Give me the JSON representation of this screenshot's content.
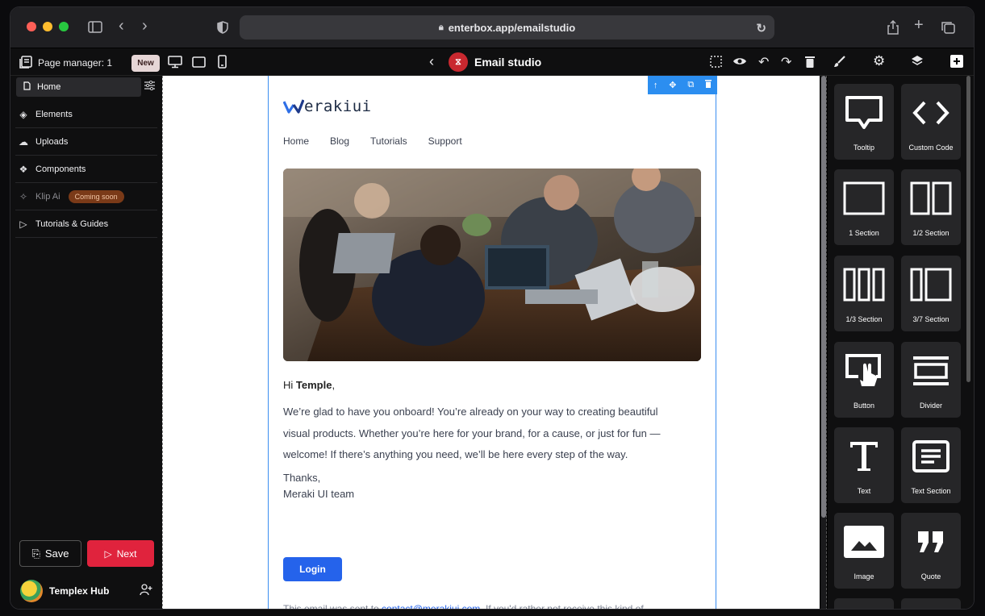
{
  "browser": {
    "url": "enterbox.app/emailstudio",
    "lock_icon": "lock-icon"
  },
  "toolbar": {
    "page_manager": "Page manager: 1",
    "new_badge": "New",
    "title": "Email studio"
  },
  "sidebar": {
    "home": "Home",
    "items": [
      {
        "label": "Elements",
        "icon": "elements-icon"
      },
      {
        "label": "Uploads",
        "icon": "upload-icon"
      },
      {
        "label": "Components",
        "icon": "components-icon"
      },
      {
        "label": "Klip Ai",
        "icon": "magic-icon",
        "badge": "Coming soon"
      },
      {
        "label": "Tutorials & Guides",
        "icon": "video-icon"
      }
    ],
    "save": "Save",
    "next": "Next",
    "hub": "Templex Hub"
  },
  "email": {
    "brand": "erakiui",
    "nav": [
      "Home",
      "Blog",
      "Tutorials",
      "Support"
    ],
    "greeting_prefix": "Hi ",
    "greeting_name": "Temple",
    "greeting_suffix": ",",
    "body": "We’re glad to have you onboard! You’re already on your way to creating beautiful visual products. Whether you’re here for your brand, for a cause, or just for fun — welcome! If there’s anything you need, we’ll be here every step of the way.",
    "thanks": "Thanks,",
    "signature": "Meraki UI team",
    "login": "Login",
    "footer_prefix": "This email was sent to ",
    "footer_email": "contact@merakiui.com",
    "footer_suffix": ". If you'd rather not receive this kind of"
  },
  "panel": {
    "tiles": [
      "Tooltip",
      "Custom Code",
      "1 Section",
      "1/2 Section",
      "1/3 Section",
      "3/7 Section",
      "Button",
      "Divider",
      "Text",
      "Text Section",
      "Image",
      "Quote"
    ]
  }
}
